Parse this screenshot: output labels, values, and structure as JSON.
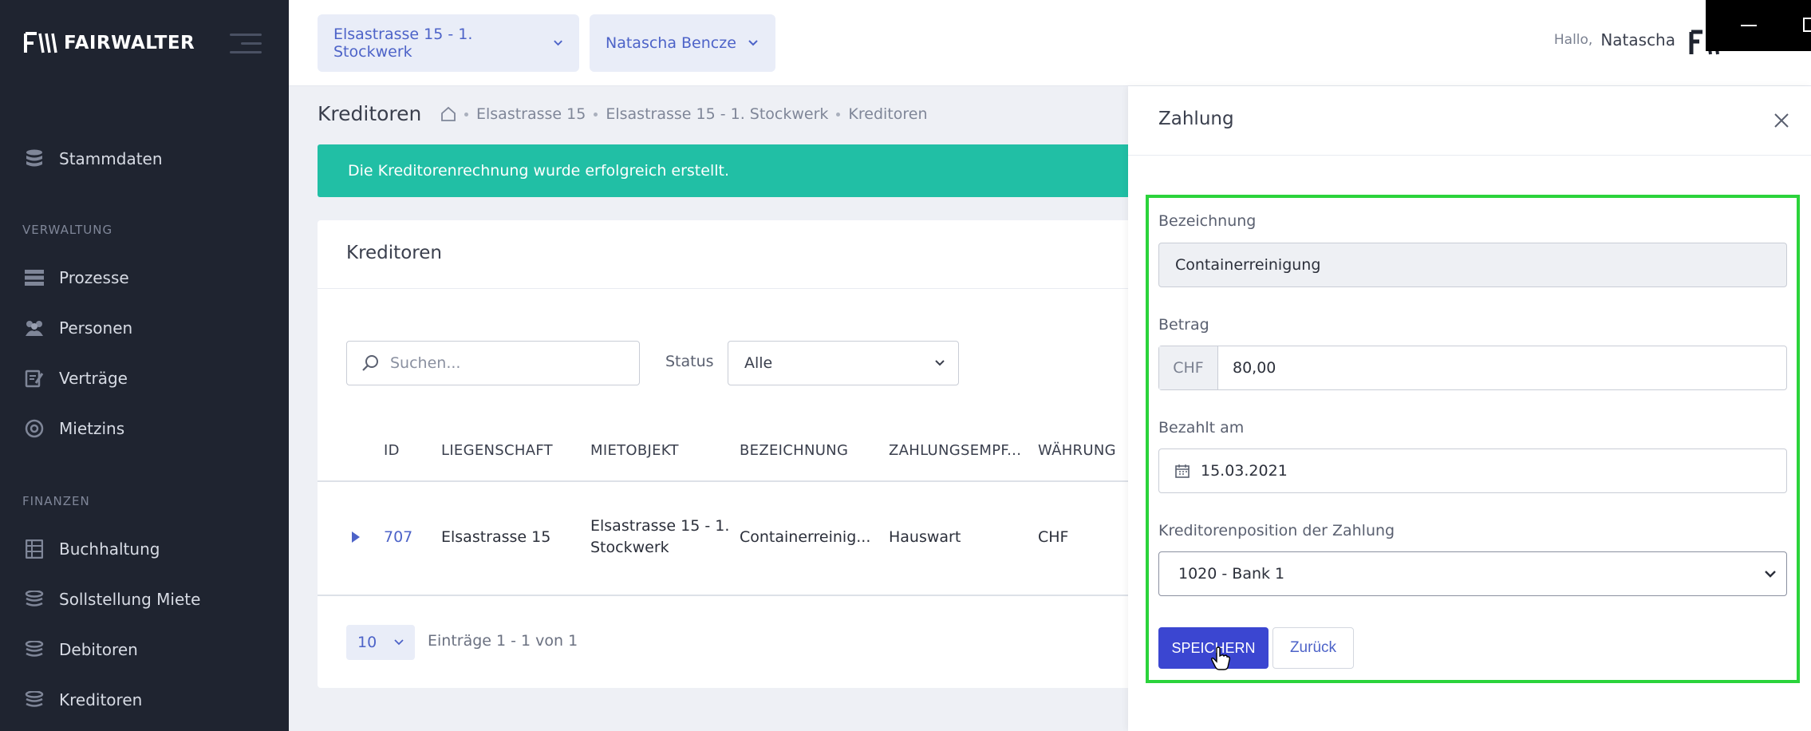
{
  "app": {
    "brand": "FAIRWALTER"
  },
  "sidebar": {
    "top_item": {
      "label": "Stammdaten",
      "icon": "database-icon"
    },
    "sections": [
      {
        "label": "VERWALTUNG"
      },
      {
        "label": "FINANZEN"
      }
    ],
    "items": [
      {
        "label": "Prozesse",
        "icon": "process-icon"
      },
      {
        "label": "Personen",
        "icon": "people-icon"
      },
      {
        "label": "Verträge",
        "icon": "contract-icon"
      },
      {
        "label": "Mietzins",
        "icon": "rent-icon"
      },
      {
        "label": "Buchhaltung",
        "icon": "ledger-icon"
      },
      {
        "label": "Sollstellung Miete",
        "icon": "coins-icon"
      },
      {
        "label": "Debitoren",
        "icon": "coins-icon"
      },
      {
        "label": "Kreditoren",
        "icon": "coins-icon"
      }
    ]
  },
  "topbar": {
    "property_select": "Elsastrasse 15 - 1. Stockwerk",
    "person_select": "Natascha Bencze",
    "greeting": "Hallo,",
    "user_name": "Natascha"
  },
  "page": {
    "title": "Kreditoren",
    "breadcrumb": [
      "Elsastrasse 15",
      "Elsastrasse 15 - 1. Stockwerk",
      "Kreditoren"
    ],
    "alert": "Die Kreditorenrechnung wurde erfolgreich erstellt."
  },
  "card": {
    "title": "Kreditoren",
    "search_placeholder": "Suchen...",
    "status_label": "Status",
    "status_value": "Alle",
    "columns": [
      "ID",
      "LIEGENSCHAFT",
      "MIETOBJEKT",
      "BEZEICHNUNG",
      "ZAHLUNGSEMPF...",
      "WÄHRUNG"
    ],
    "rows": [
      {
        "id": "707",
        "liegenschaft": "Elsastrasse 15",
        "mietobjekt_1": "Elsastrasse 15 - 1.",
        "mietobjekt_2": "Stockwerk",
        "bezeichnung": "Containerreinig...",
        "empfaenger": "Hauswart",
        "waehrung": "CHF"
      }
    ],
    "page_size": "10",
    "pager_text": "Einträge 1 - 1 von 1"
  },
  "panel": {
    "title": "Zahlung",
    "bezeichnung_label": "Bezeichnung",
    "bezeichnung_value": "Containerreinigung",
    "betrag_label": "Betrag",
    "currency": "CHF",
    "betrag_value": "80,00",
    "bezahlt_label": "Bezahlt am",
    "bezahlt_value": "15.03.2021",
    "position_label": "Kreditorenposition der Zahlung",
    "position_value": "1020 - Bank 1",
    "save_label": "SPEICHERN",
    "back_label": "Zurück"
  },
  "colors": {
    "sidebar": "#1f2430",
    "accent": "#3b46d1",
    "success": "#21bfa5",
    "highlight": "#2bd33b"
  }
}
